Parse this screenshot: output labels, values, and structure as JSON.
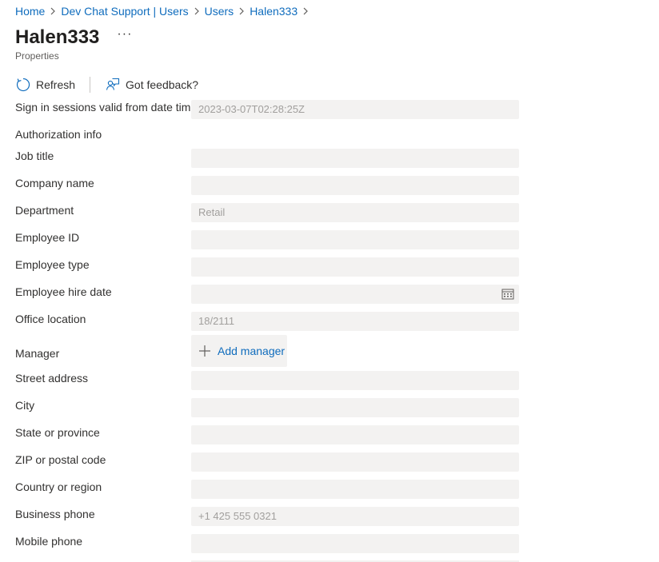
{
  "breadcrumb": {
    "items": [
      "Home",
      "Dev Chat Support | Users",
      "Users",
      "Halen333"
    ]
  },
  "header": {
    "title": "Halen333",
    "more_label": "···",
    "subtitle": "Properties"
  },
  "toolbar": {
    "refresh_label": "Refresh",
    "refresh_icon": "refresh-icon",
    "feedback_label": "Got feedback?",
    "feedback_icon": "feedback-icon"
  },
  "form": {
    "sign_in_sessions_label": "Sign in sessions valid from date time",
    "sign_in_sessions_value": "2023-03-07T02:28:25Z",
    "authorization_info_label": "Authorization info",
    "job_title_label": "Job title",
    "job_title_value": "",
    "company_name_label": "Company name",
    "company_name_value": "",
    "department_label": "Department",
    "department_value": "Retail",
    "employee_id_label": "Employee ID",
    "employee_id_value": "",
    "employee_type_label": "Employee type",
    "employee_type_value": "",
    "employee_hire_date_label": "Employee hire date",
    "employee_hire_date_value": "",
    "office_location_label": "Office location",
    "office_location_value": "18/2111",
    "manager_label": "Manager",
    "add_manager_label": "Add manager",
    "street_address_label": "Street address",
    "street_address_value": "",
    "city_label": "City",
    "city_value": "",
    "state_label": "State or province",
    "state_value": "",
    "zip_label": "ZIP or postal code",
    "zip_value": "",
    "country_label": "Country or region",
    "country_value": "",
    "business_phone_label": "Business phone",
    "business_phone_value": "+1 425 555 0321",
    "mobile_phone_label": "Mobile phone",
    "mobile_phone_value": ""
  },
  "colors": {
    "link": "#0f6cbd",
    "field_bg": "#f3f2f1",
    "text": "#323130",
    "placeholder_text": "#a19f9d"
  }
}
